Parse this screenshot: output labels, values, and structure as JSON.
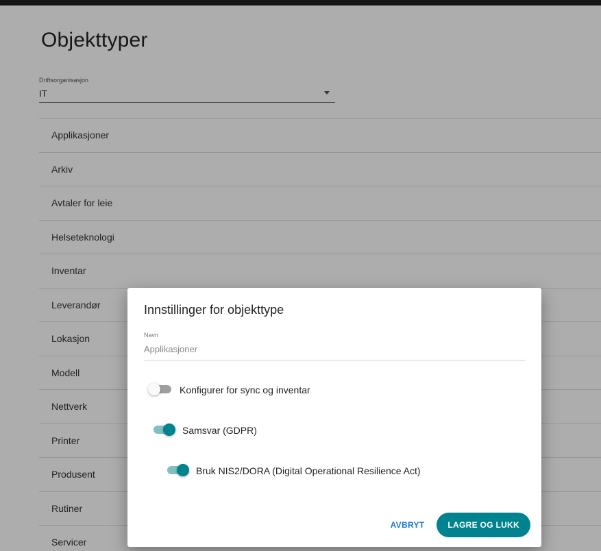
{
  "page": {
    "title": "Objekttyper",
    "select": {
      "label": "Driftsorganisasjon",
      "value": "IT"
    },
    "items": [
      "Applikasjoner",
      "Arkiv",
      "Avtaler for leie",
      "Helseteknologi",
      "Inventar",
      "Leverandør",
      "Lokasjon",
      "Modell",
      "Nettverk",
      "Printer",
      "Produsent",
      "Rutiner",
      "Servicer"
    ]
  },
  "dialog": {
    "title": "Innstillinger for objekttype",
    "field_label": "Navn",
    "field_value": "Applikasjoner",
    "toggles": [
      {
        "label": "Konfigurer for sync og inventar",
        "state": "off"
      },
      {
        "label": "Samsvar (GDPR)",
        "state": "on"
      },
      {
        "label": "Bruk NIS2/DORA (Digital Operational Resilience Act)",
        "state": "on"
      }
    ],
    "cancel_label": "AVBRYT",
    "save_label": "LAGRE OG LUKK"
  },
  "colors": {
    "accent": "#00838f",
    "link": "#1976d2"
  }
}
